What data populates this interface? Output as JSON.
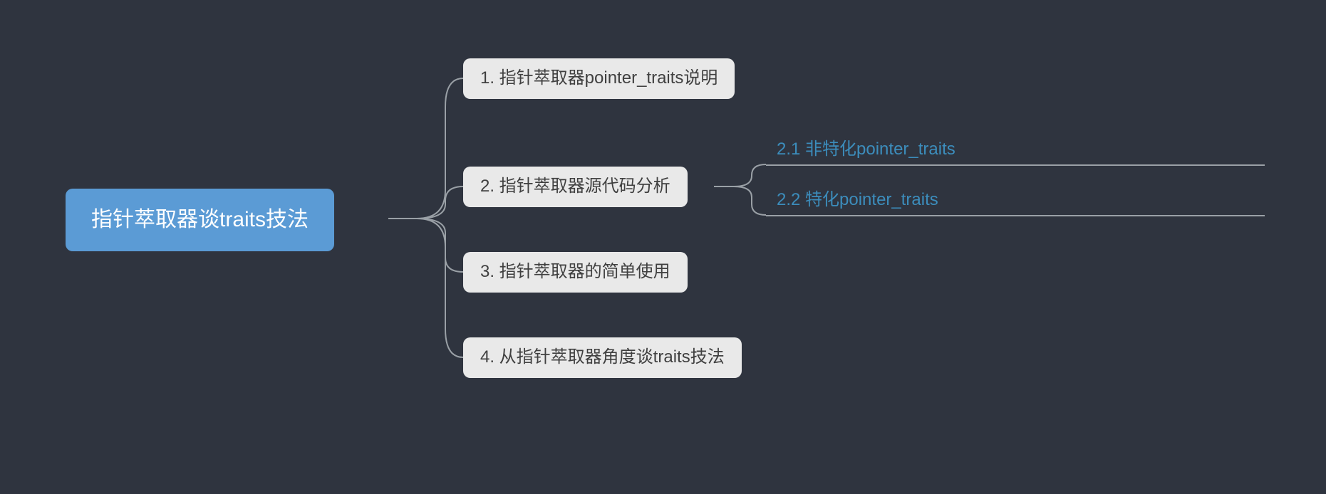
{
  "root": {
    "label": "指针萃取器谈traits技法"
  },
  "children": [
    {
      "label": "1. 指针萃取器pointer_traits说明"
    },
    {
      "label": "2. 指针萃取器源代码分析"
    },
    {
      "label": "3. 指针萃取器的简单使用"
    },
    {
      "label": "4. 从指针萃取器角度谈traits技法"
    }
  ],
  "leaves": [
    {
      "label": "2.1 非特化pointer_traits"
    },
    {
      "label": "2.2 特化pointer_traits"
    }
  ],
  "colors": {
    "background": "#2f343f",
    "root_bg": "#5b9bd5",
    "root_fg": "#ffffff",
    "child_bg": "#e9e9e9",
    "child_fg": "#404040",
    "leaf_fg": "#3c8dbc",
    "connector": "#9aa0a6"
  }
}
